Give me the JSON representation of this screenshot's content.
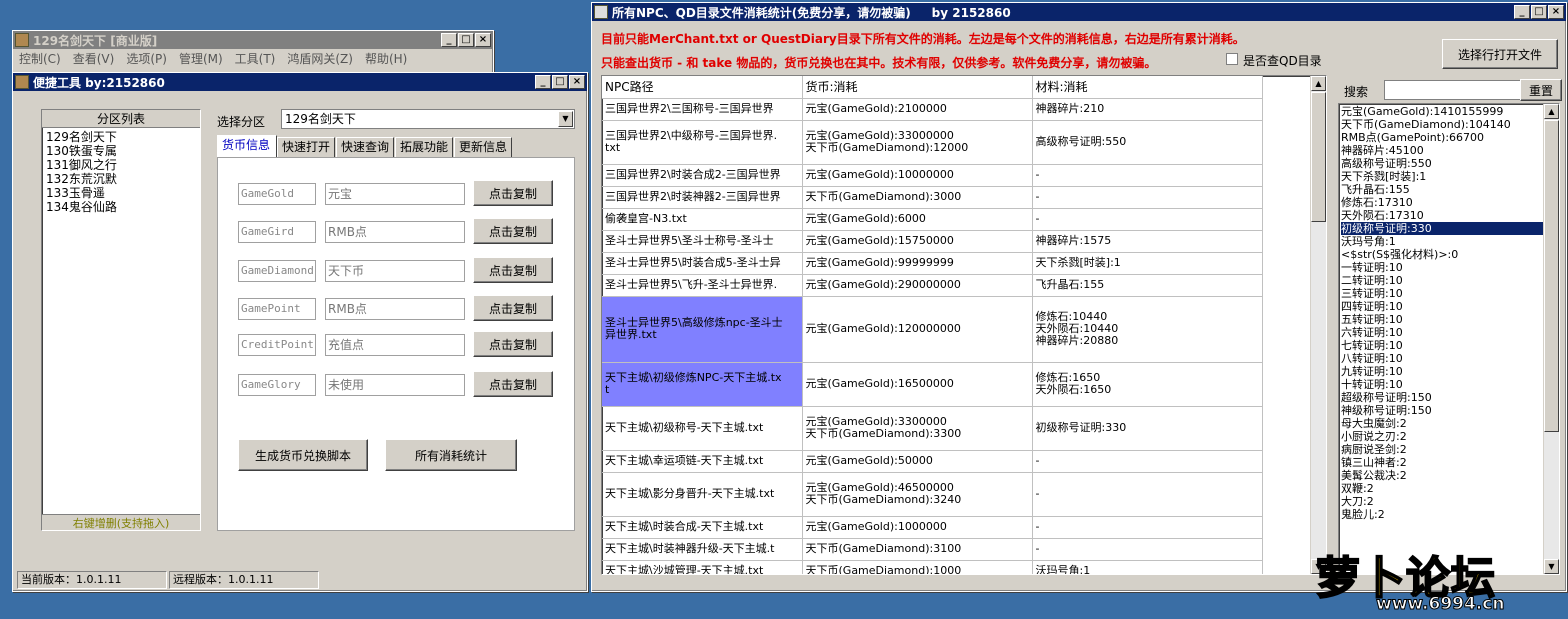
{
  "main_window": {
    "title": "129名剑天下 [商业版]",
    "menu": [
      "控制(C)",
      "查看(V)",
      "选项(P)",
      "管理(M)",
      "工具(T)",
      "鸿盾网关(Z)",
      "帮助(H)"
    ]
  },
  "tool_window": {
    "title": "便捷工具  by:2152860",
    "zone_list": {
      "header": "分区列表",
      "items": [
        "129名剑天下",
        "130铁蛋专属",
        "131御风之行",
        "132东荒沉默",
        "133玉骨遥",
        "134鬼谷仙路"
      ],
      "footer": "右键增删(支持拖入)"
    },
    "zone_select": {
      "label": "选择分区",
      "value": "129名剑天下"
    },
    "tabs": [
      "货币信息",
      "快速打开",
      "快速查询",
      "拓展功能",
      "更新信息"
    ],
    "currencies": [
      {
        "code": "GameGold",
        "name": "元宝",
        "button": "点击复制"
      },
      {
        "code": "GameGird",
        "name": "RMB点",
        "button": "点击复制"
      },
      {
        "code": "GameDiamond",
        "name": "天下币",
        "button": "点击复制"
      },
      {
        "code": "GamePoint",
        "name": "RMB点",
        "button": "点击复制"
      },
      {
        "code": "CreditPoint",
        "name": "充值点",
        "button": "点击复制"
      },
      {
        "code": "GameGlory",
        "name": "未使用",
        "button": "点击复制"
      }
    ],
    "gen_button": "生成货币兑换脚本",
    "stats_button": "所有消耗统计",
    "status_current": "当前版本：1.0.1.11",
    "status_remote": "远程版本：1.0.1.11"
  },
  "stats_window": {
    "title": "所有NPC、QD目录文件消耗统计(免费分享，请勿被骗)     by 2152860",
    "notice1": "目前只能MerChant.txt or QuestDiary目录下所有文件的消耗。左边是每个文件的消耗信息，右边是所有累计消耗。",
    "notice2": "只能查出货币 - 和 take 物品的，货币兑换也在其中。技术有限，仅供参考。软件免费分享，请勿被骗。",
    "checkbox_label": "是否查QD目录",
    "open_button": "选择行打开文件",
    "search_label": "搜索",
    "reset_button": "重置",
    "columns": [
      "NPC路径",
      "货币:消耗",
      "材料:消耗"
    ],
    "rows": [
      {
        "path": "三国异世界2\\三国称号-三国异世界",
        "cur": "元宝(GameGold):2100000",
        "mat": "神器碎片:210"
      },
      {
        "path": "三国异世界2\\中级称号-三国异世界.\ntxt",
        "cur": "元宝(GameGold):33000000\n天下币(GameDiamond):12000",
        "mat": "高级称号证明:550"
      },
      {
        "path": "三国异世界2\\时装合成2-三国异世界",
        "cur": "元宝(GameGold):10000000",
        "mat": "-"
      },
      {
        "path": "三国异世界2\\时装神器2-三国异世界",
        "cur": "天下币(GameDiamond):3000",
        "mat": "-"
      },
      {
        "path": "偷袭皇宫-N3.txt",
        "cur": "元宝(GameGold):6000",
        "mat": "-"
      },
      {
        "path": "圣斗士异世界5\\圣斗士称号-圣斗士",
        "cur": "元宝(GameGold):15750000",
        "mat": "神器碎片:1575"
      },
      {
        "path": "圣斗士异世界5\\时装合成5-圣斗士异",
        "cur": "元宝(GameGold):99999999",
        "mat": "天下杀戮[时装]:1"
      },
      {
        "path": "圣斗士异世界5\\飞升-圣斗士异世界.",
        "cur": "元宝(GameGold):290000000",
        "mat": "飞升晶石:155"
      },
      {
        "path": "圣斗士异世界5\\高级修炼npc-圣斗士\n异世界.txt",
        "cur": "元宝(GameGold):120000000",
        "mat": "修炼石:10440\n天外陨石:10440\n神器碎片:20880"
      },
      {
        "path": "天下主城\\初级修炼NPC-天下主城.tx\nt",
        "cur": "元宝(GameGold):16500000",
        "mat": "修炼石:1650\n天外陨石:1650"
      },
      {
        "path": "天下主城\\初级称号-天下主城.txt",
        "cur": "元宝(GameGold):3300000\n天下币(GameDiamond):3300",
        "mat": "初级称号证明:330"
      },
      {
        "path": "天下主城\\幸运项链-天下主城.txt",
        "cur": "元宝(GameGold):50000",
        "mat": "-"
      },
      {
        "path": "天下主城\\影分身晋升-天下主城.txt",
        "cur": "元宝(GameGold):46500000\n天下币(GameDiamond):3240",
        "mat": "-"
      },
      {
        "path": "天下主城\\时装合成-天下主城.txt",
        "cur": "元宝(GameGold):1000000",
        "mat": "-"
      },
      {
        "path": "天下主城\\时装神器升级-天下主城.t",
        "cur": "天下币(GameDiamond):3100",
        "mat": "-"
      },
      {
        "path": "天下主城\\沙城管理-天下主城.txt",
        "cur": "天下币(GameDiamond):1000",
        "mat": "沃玛号角:1"
      }
    ],
    "totals": [
      "元宝(GameGold):1410155999",
      "天下币(GameDiamond):104140",
      "RMB点(GamePoint):66700",
      "神器碎片:45100",
      "高级称号证明:550",
      "天下杀戮[时装]:1",
      "飞升晶石:155",
      "修炼石:17310",
      "天外陨石:17310",
      "初级称号证明:330",
      "沃玛号角:1",
      "<$str(S$强化材料)>:0",
      "一转证明:10",
      "二转证明:10",
      "三转证明:10",
      "四转证明:10",
      "五转证明:10",
      "六转证明:10",
      "七转证明:10",
      "八转证明:10",
      "九转证明:10",
      "十转证明:10",
      "超级称号证明:150",
      "神级称号证明:150",
      "母大虫魔剑:2",
      "小厨说之刃:2",
      "病厨说圣剑:2",
      "镇三山神者:2",
      "美髯公裁决:2",
      "双鞭:2",
      "大刀:2",
      "鬼脸儿:2"
    ],
    "selected_total_index": 9
  },
  "watermark": {
    "brand": "萝卜论坛",
    "url": "www.6994.cn"
  }
}
